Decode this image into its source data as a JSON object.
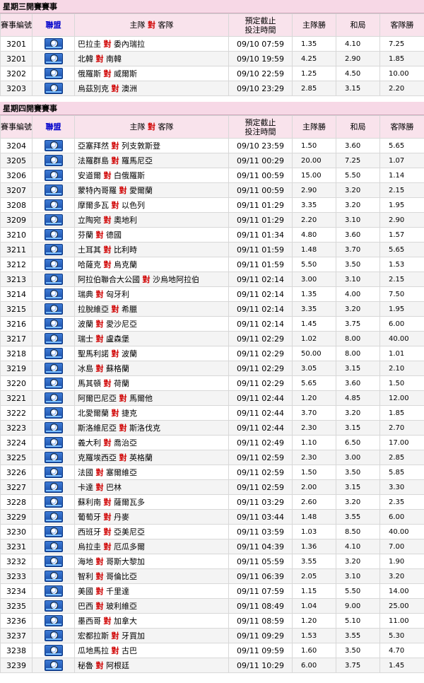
{
  "header": {
    "code": "賽事編號",
    "league": "聯盟",
    "home": "主隊",
    "vs": "對",
    "away": "客隊",
    "time_line1": "預定截止",
    "time_line2": "投注時間",
    "home_win": "主隊勝",
    "draw": "和局",
    "away_win": "客隊勝"
  },
  "sections": [
    {
      "title": "星期三開賽賽事",
      "matches": [
        {
          "code": "3201",
          "home": "巴拉圭",
          "away": "委內瑞拉",
          "time": "09/10 07:59",
          "h": "1.35",
          "d": "4.10",
          "a": "7.25"
        },
        {
          "code": "3201",
          "home": "北韓",
          "away": "南韓",
          "time": "09/10 19:59",
          "h": "4.25",
          "d": "2.90",
          "a": "1.85"
        },
        {
          "code": "3202",
          "home": "俄羅斯",
          "away": "威爾斯",
          "time": "09/10 22:59",
          "h": "1.25",
          "d": "4.50",
          "a": "10.00"
        },
        {
          "code": "3203",
          "home": "烏茲別克",
          "away": "澳洲",
          "time": "09/10 23:29",
          "h": "2.85",
          "d": "3.15",
          "a": "2.20"
        }
      ]
    },
    {
      "title": "星期四開賽賽事",
      "matches": [
        {
          "code": "3204",
          "home": "亞塞拜然",
          "away": "列支敦斯登",
          "time": "09/10 23:59",
          "h": "1.50",
          "d": "3.60",
          "a": "5.65"
        },
        {
          "code": "3205",
          "home": "法羅群島",
          "away": "羅馬尼亞",
          "time": "09/11 00:29",
          "h": "20.00",
          "d": "7.25",
          "a": "1.07"
        },
        {
          "code": "3206",
          "home": "安道爾",
          "away": "白俄羅斯",
          "time": "09/11 00:59",
          "h": "15.00",
          "d": "5.50",
          "a": "1.14"
        },
        {
          "code": "3207",
          "home": "蒙特內哥羅",
          "away": "愛爾蘭",
          "time": "09/11 00:59",
          "h": "2.90",
          "d": "3.20",
          "a": "2.15"
        },
        {
          "code": "3208",
          "home": "摩爾多瓦",
          "away": "以色列",
          "time": "09/11 01:29",
          "h": "3.35",
          "d": "3.20",
          "a": "1.95"
        },
        {
          "code": "3209",
          "home": "立陶宛",
          "away": "奧地利",
          "time": "09/11 01:29",
          "h": "2.20",
          "d": "3.10",
          "a": "2.90"
        },
        {
          "code": "3210",
          "home": "芬蘭",
          "away": "德國",
          "time": "09/11 01:34",
          "h": "4.80",
          "d": "3.60",
          "a": "1.57"
        },
        {
          "code": "3211",
          "home": "土耳其",
          "away": "比利時",
          "time": "09/11 01:59",
          "h": "1.48",
          "d": "3.70",
          "a": "5.65"
        },
        {
          "code": "3212",
          "home": "哈薩克",
          "away": "烏克蘭",
          "time": "09/11 01:59",
          "h": "5.50",
          "d": "3.50",
          "a": "1.53"
        },
        {
          "code": "3213",
          "home": "阿拉伯聯合大公國",
          "away": "沙烏地阿拉伯",
          "time": "09/11 02:14",
          "h": "3.00",
          "d": "3.10",
          "a": "2.15"
        },
        {
          "code": "3214",
          "home": "瑞典",
          "away": "匈牙利",
          "time": "09/11 02:14",
          "h": "1.35",
          "d": "4.00",
          "a": "7.50"
        },
        {
          "code": "3215",
          "home": "拉脫維亞",
          "away": "希臘",
          "time": "09/11 02:14",
          "h": "3.35",
          "d": "3.20",
          "a": "1.95"
        },
        {
          "code": "3216",
          "home": "波蘭",
          "away": "愛沙尼亞",
          "time": "09/11 02:14",
          "h": "1.45",
          "d": "3.75",
          "a": "6.00"
        },
        {
          "code": "3217",
          "home": "瑞士",
          "away": "盧森堡",
          "time": "09/11 02:29",
          "h": "1.02",
          "d": "8.00",
          "a": "40.00"
        },
        {
          "code": "3218",
          "home": "聖馬利諾",
          "away": "波蘭",
          "time": "09/11 02:29",
          "h": "50.00",
          "d": "8.00",
          "a": "1.01"
        },
        {
          "code": "3219",
          "home": "冰島",
          "away": "蘇格蘭",
          "time": "09/11 02:29",
          "h": "3.05",
          "d": "3.15",
          "a": "2.10"
        },
        {
          "code": "3220",
          "home": "馬其頓",
          "away": "荷蘭",
          "time": "09/11 02:29",
          "h": "5.65",
          "d": "3.60",
          "a": "1.50"
        },
        {
          "code": "3221",
          "home": "阿爾巴尼亞",
          "away": "馬爾他",
          "time": "09/11 02:44",
          "h": "1.20",
          "d": "4.85",
          "a": "12.00"
        },
        {
          "code": "3222",
          "home": "北愛爾蘭",
          "away": "捷克",
          "time": "09/11 02:44",
          "h": "3.70",
          "d": "3.20",
          "a": "1.85"
        },
        {
          "code": "3223",
          "home": "斯洛維尼亞",
          "away": "斯洛伐克",
          "time": "09/11 02:44",
          "h": "2.30",
          "d": "3.15",
          "a": "2.70"
        },
        {
          "code": "3224",
          "home": "義大利",
          "away": "喬治亞",
          "time": "09/11 02:49",
          "h": "1.10",
          "d": "6.50",
          "a": "17.00"
        },
        {
          "code": "3225",
          "home": "克羅埃西亞",
          "away": "英格蘭",
          "time": "09/11 02:59",
          "h": "2.30",
          "d": "3.00",
          "a": "2.85"
        },
        {
          "code": "3226",
          "home": "法國",
          "away": "塞爾維亞",
          "time": "09/11 02:59",
          "h": "1.50",
          "d": "3.50",
          "a": "5.85"
        },
        {
          "code": "3227",
          "home": "卡達",
          "away": "巴林",
          "time": "09/11 02:59",
          "h": "2.00",
          "d": "3.15",
          "a": "3.30"
        },
        {
          "code": "3228",
          "home": "蘇利南",
          "away": "薩爾瓦多",
          "time": "09/11 03:29",
          "h": "2.60",
          "d": "3.20",
          "a": "2.35"
        },
        {
          "code": "3229",
          "home": "葡萄牙",
          "away": "丹麥",
          "time": "09/11 03:44",
          "h": "1.48",
          "d": "3.55",
          "a": "6.00"
        },
        {
          "code": "3230",
          "home": "西班牙",
          "away": "亞美尼亞",
          "time": "09/11 03:59",
          "h": "1.03",
          "d": "8.50",
          "a": "40.00"
        },
        {
          "code": "3231",
          "home": "烏拉圭",
          "away": "厄瓜多爾",
          "time": "09/11 04:39",
          "h": "1.36",
          "d": "4.10",
          "a": "7.00"
        },
        {
          "code": "3232",
          "home": "海地",
          "away": "哥斯大黎加",
          "time": "09/11 05:59",
          "h": "3.55",
          "d": "3.20",
          "a": "1.90"
        },
        {
          "code": "3233",
          "home": "智利",
          "away": "哥倫比亞",
          "time": "09/11 06:39",
          "h": "2.05",
          "d": "3.10",
          "a": "3.20"
        },
        {
          "code": "3234",
          "home": "美國",
          "away": "千里達",
          "time": "09/11 07:59",
          "h": "1.15",
          "d": "5.50",
          "a": "14.00"
        },
        {
          "code": "3235",
          "home": "巴西",
          "away": "玻利維亞",
          "time": "09/11 08:49",
          "h": "1.04",
          "d": "9.00",
          "a": "25.00"
        },
        {
          "code": "3236",
          "home": "墨西哥",
          "away": "加拿大",
          "time": "09/11 08:59",
          "h": "1.20",
          "d": "5.10",
          "a": "11.00"
        },
        {
          "code": "3237",
          "home": "宏都拉斯",
          "away": "牙買加",
          "time": "09/11 09:29",
          "h": "1.53",
          "d": "3.55",
          "a": "5.30"
        },
        {
          "code": "3238",
          "home": "瓜地馬拉",
          "away": "古巴",
          "time": "09/11 09:59",
          "h": "1.60",
          "d": "3.50",
          "a": "4.70"
        },
        {
          "code": "3239",
          "home": "秘魯",
          "away": "阿根廷",
          "time": "09/11 10:29",
          "h": "6.00",
          "d": "3.75",
          "a": "1.45"
        }
      ]
    }
  ]
}
